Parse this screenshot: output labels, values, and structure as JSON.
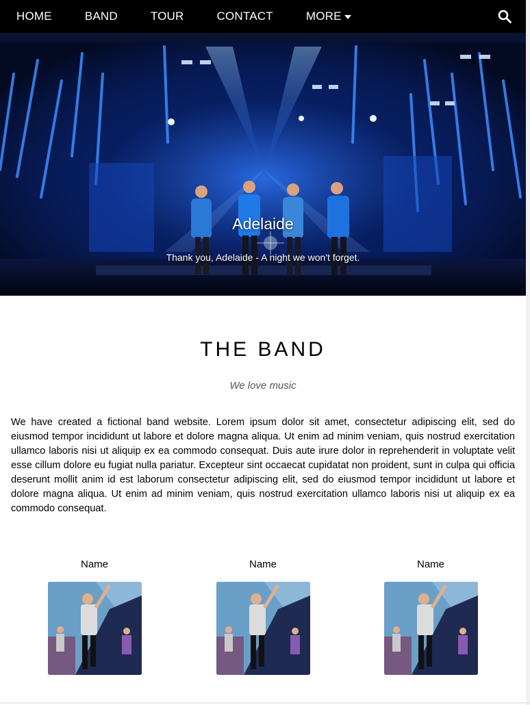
{
  "nav": {
    "items": [
      {
        "label": "HOME"
      },
      {
        "label": "BAND"
      },
      {
        "label": "TOUR"
      },
      {
        "label": "CONTACT"
      },
      {
        "label": "MORE"
      }
    ],
    "more_icon": "caret-down-icon",
    "search_icon": "search-icon"
  },
  "hero": {
    "title": "Adelaide",
    "subtitle": "Thank you, Adelaide - A night we won't forget."
  },
  "band": {
    "title": "THE BAND",
    "tagline": "We love music",
    "description": "We have created a fictional band website. Lorem ipsum dolor sit amet, consectetur adipiscing elit, sed do eiusmod tempor incididunt ut labore et dolore magna aliqua. Ut enim ad minim veniam, quis nostrud exercitation ullamco laboris nisi ut aliquip ex ea commodo consequat. Duis aute irure dolor in reprehenderit in voluptate velit esse cillum dolore eu fugiat nulla pariatur. Excepteur sint occaecat cupidatat non proident, sunt in culpa qui officia deserunt mollit anim id est laborum consectetur adipiscing elit, sed do eiusmod tempor incididunt ut labore et dolore magna aliqua. Ut enim ad minim veniam, quis nostrud exercitation ullamco laboris nisi ut aliquip ex ea commodo consequat.",
    "members": [
      {
        "name": "Name"
      },
      {
        "name": "Name"
      },
      {
        "name": "Name"
      }
    ]
  },
  "colors": {
    "nav_bg": "#000000",
    "nav_text": "#ffffff",
    "hero_bg": "#040b24",
    "stage_blue": "#1e6cff",
    "tagline": "#555555"
  }
}
